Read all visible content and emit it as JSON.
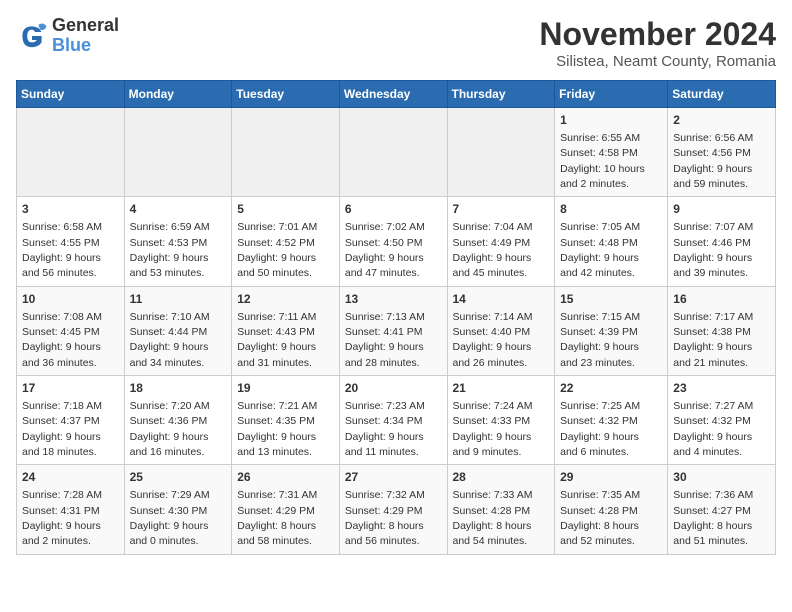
{
  "logo": {
    "line1": "General",
    "line2": "Blue"
  },
  "title": "November 2024",
  "location": "Silistea, Neamt County, Romania",
  "days_of_week": [
    "Sunday",
    "Monday",
    "Tuesday",
    "Wednesday",
    "Thursday",
    "Friday",
    "Saturday"
  ],
  "weeks": [
    [
      {
        "day": "",
        "info": ""
      },
      {
        "day": "",
        "info": ""
      },
      {
        "day": "",
        "info": ""
      },
      {
        "day": "",
        "info": ""
      },
      {
        "day": "",
        "info": ""
      },
      {
        "day": "1",
        "info": "Sunrise: 6:55 AM\nSunset: 4:58 PM\nDaylight: 10 hours\nand 2 minutes."
      },
      {
        "day": "2",
        "info": "Sunrise: 6:56 AM\nSunset: 4:56 PM\nDaylight: 9 hours\nand 59 minutes."
      }
    ],
    [
      {
        "day": "3",
        "info": "Sunrise: 6:58 AM\nSunset: 4:55 PM\nDaylight: 9 hours\nand 56 minutes."
      },
      {
        "day": "4",
        "info": "Sunrise: 6:59 AM\nSunset: 4:53 PM\nDaylight: 9 hours\nand 53 minutes."
      },
      {
        "day": "5",
        "info": "Sunrise: 7:01 AM\nSunset: 4:52 PM\nDaylight: 9 hours\nand 50 minutes."
      },
      {
        "day": "6",
        "info": "Sunrise: 7:02 AM\nSunset: 4:50 PM\nDaylight: 9 hours\nand 47 minutes."
      },
      {
        "day": "7",
        "info": "Sunrise: 7:04 AM\nSunset: 4:49 PM\nDaylight: 9 hours\nand 45 minutes."
      },
      {
        "day": "8",
        "info": "Sunrise: 7:05 AM\nSunset: 4:48 PM\nDaylight: 9 hours\nand 42 minutes."
      },
      {
        "day": "9",
        "info": "Sunrise: 7:07 AM\nSunset: 4:46 PM\nDaylight: 9 hours\nand 39 minutes."
      }
    ],
    [
      {
        "day": "10",
        "info": "Sunrise: 7:08 AM\nSunset: 4:45 PM\nDaylight: 9 hours\nand 36 minutes."
      },
      {
        "day": "11",
        "info": "Sunrise: 7:10 AM\nSunset: 4:44 PM\nDaylight: 9 hours\nand 34 minutes."
      },
      {
        "day": "12",
        "info": "Sunrise: 7:11 AM\nSunset: 4:43 PM\nDaylight: 9 hours\nand 31 minutes."
      },
      {
        "day": "13",
        "info": "Sunrise: 7:13 AM\nSunset: 4:41 PM\nDaylight: 9 hours\nand 28 minutes."
      },
      {
        "day": "14",
        "info": "Sunrise: 7:14 AM\nSunset: 4:40 PM\nDaylight: 9 hours\nand 26 minutes."
      },
      {
        "day": "15",
        "info": "Sunrise: 7:15 AM\nSunset: 4:39 PM\nDaylight: 9 hours\nand 23 minutes."
      },
      {
        "day": "16",
        "info": "Sunrise: 7:17 AM\nSunset: 4:38 PM\nDaylight: 9 hours\nand 21 minutes."
      }
    ],
    [
      {
        "day": "17",
        "info": "Sunrise: 7:18 AM\nSunset: 4:37 PM\nDaylight: 9 hours\nand 18 minutes."
      },
      {
        "day": "18",
        "info": "Sunrise: 7:20 AM\nSunset: 4:36 PM\nDaylight: 9 hours\nand 16 minutes."
      },
      {
        "day": "19",
        "info": "Sunrise: 7:21 AM\nSunset: 4:35 PM\nDaylight: 9 hours\nand 13 minutes."
      },
      {
        "day": "20",
        "info": "Sunrise: 7:23 AM\nSunset: 4:34 PM\nDaylight: 9 hours\nand 11 minutes."
      },
      {
        "day": "21",
        "info": "Sunrise: 7:24 AM\nSunset: 4:33 PM\nDaylight: 9 hours\nand 9 minutes."
      },
      {
        "day": "22",
        "info": "Sunrise: 7:25 AM\nSunset: 4:32 PM\nDaylight: 9 hours\nand 6 minutes."
      },
      {
        "day": "23",
        "info": "Sunrise: 7:27 AM\nSunset: 4:32 PM\nDaylight: 9 hours\nand 4 minutes."
      }
    ],
    [
      {
        "day": "24",
        "info": "Sunrise: 7:28 AM\nSunset: 4:31 PM\nDaylight: 9 hours\nand 2 minutes."
      },
      {
        "day": "25",
        "info": "Sunrise: 7:29 AM\nSunset: 4:30 PM\nDaylight: 9 hours\nand 0 minutes."
      },
      {
        "day": "26",
        "info": "Sunrise: 7:31 AM\nSunset: 4:29 PM\nDaylight: 8 hours\nand 58 minutes."
      },
      {
        "day": "27",
        "info": "Sunrise: 7:32 AM\nSunset: 4:29 PM\nDaylight: 8 hours\nand 56 minutes."
      },
      {
        "day": "28",
        "info": "Sunrise: 7:33 AM\nSunset: 4:28 PM\nDaylight: 8 hours\nand 54 minutes."
      },
      {
        "day": "29",
        "info": "Sunrise: 7:35 AM\nSunset: 4:28 PM\nDaylight: 8 hours\nand 52 minutes."
      },
      {
        "day": "30",
        "info": "Sunrise: 7:36 AM\nSunset: 4:27 PM\nDaylight: 8 hours\nand 51 minutes."
      }
    ]
  ]
}
